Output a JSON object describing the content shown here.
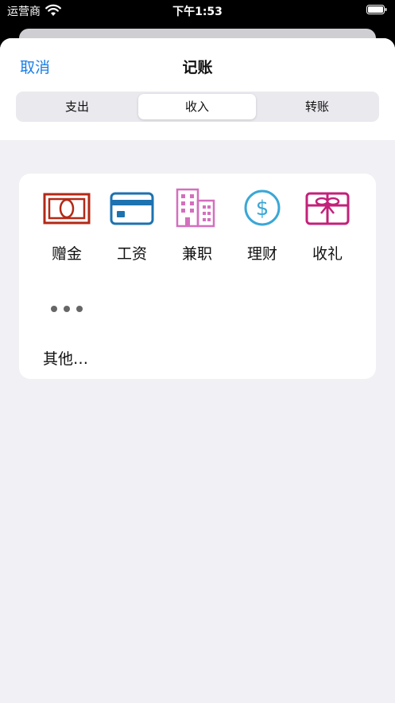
{
  "status_bar": {
    "carrier": "运营商",
    "time": "下午1:53"
  },
  "header": {
    "cancel_label": "取消",
    "title": "记账"
  },
  "segments": [
    {
      "label": "支出",
      "selected": false
    },
    {
      "label": "收入",
      "selected": true
    },
    {
      "label": "转账",
      "selected": false
    }
  ],
  "categories": [
    {
      "label": "赠金",
      "icon": "cash-bill-icon",
      "color": "#b32916"
    },
    {
      "label": "工资",
      "icon": "credit-card-icon",
      "color": "#1d72b0"
    },
    {
      "label": "兼职",
      "icon": "office-building-icon",
      "color": "#d46fbe"
    },
    {
      "label": "理财",
      "icon": "dollar-circle-icon",
      "color": "#3aa7d6"
    },
    {
      "label": "收礼",
      "icon": "gift-icon",
      "color": "#c3217a"
    }
  ],
  "more": {
    "label": "其他…",
    "icon": "ellipsis-icon"
  }
}
